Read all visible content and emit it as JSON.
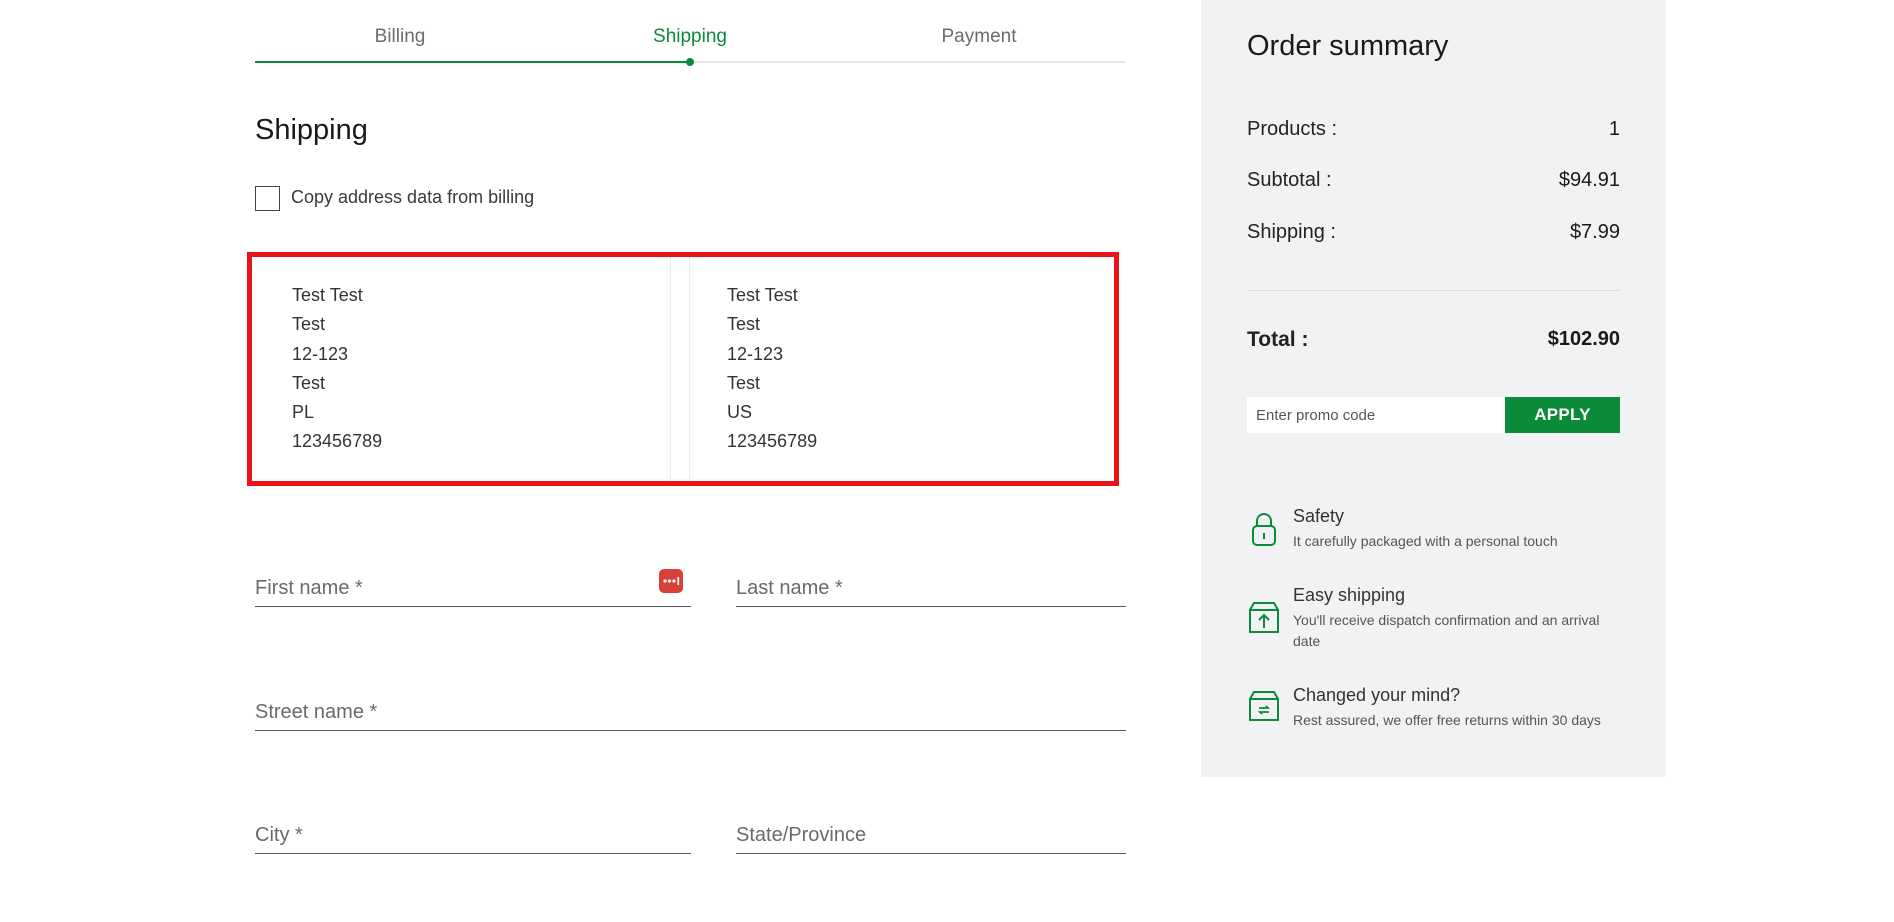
{
  "steps": [
    {
      "label": "Billing"
    },
    {
      "label": "Shipping"
    },
    {
      "label": "Payment"
    }
  ],
  "active_step": "Shipping",
  "page_title": "Shipping",
  "copy_address": {
    "label": "Copy address data from billing",
    "checked": false
  },
  "addresses": [
    {
      "lines": [
        "Test Test",
        "Test",
        "12-123",
        "Test",
        "PL",
        "123456789"
      ]
    },
    {
      "lines": [
        "Test Test",
        "Test",
        "12-123",
        "Test",
        "US",
        "123456789"
      ]
    }
  ],
  "form": {
    "first_name": {
      "placeholder": "First name *",
      "value": ""
    },
    "last_name": {
      "placeholder": "Last name *",
      "value": ""
    },
    "street_name": {
      "placeholder": "Street name *",
      "value": ""
    },
    "city": {
      "placeholder": "City *",
      "value": ""
    },
    "state": {
      "placeholder": "State/Province",
      "value": ""
    }
  },
  "summary": {
    "title": "Order summary",
    "rows": [
      {
        "label": "Products :",
        "value": "1"
      },
      {
        "label": "Subtotal :",
        "value": "$94.91"
      },
      {
        "label": "Shipping :",
        "value": "$7.99"
      }
    ],
    "total": {
      "label": "Total :",
      "value": "$102.90"
    },
    "promo_placeholder": "Enter promo code",
    "apply_label": "APPLY"
  },
  "features": [
    {
      "icon": "lock-icon",
      "title": "Safety",
      "desc": "It carefully packaged with a personal touch"
    },
    {
      "icon": "box-upload-icon",
      "title": "Easy shipping",
      "desc": "You'll receive dispatch confirmation and an arrival date"
    },
    {
      "icon": "box-return-icon",
      "title": "Changed your mind?",
      "desc": "Rest assured, we offer free returns within 30 days"
    }
  ],
  "colors": {
    "accent": "#0b8a3a",
    "highlight": "#e8141a",
    "sidebar_bg": "#f1f2f3"
  }
}
